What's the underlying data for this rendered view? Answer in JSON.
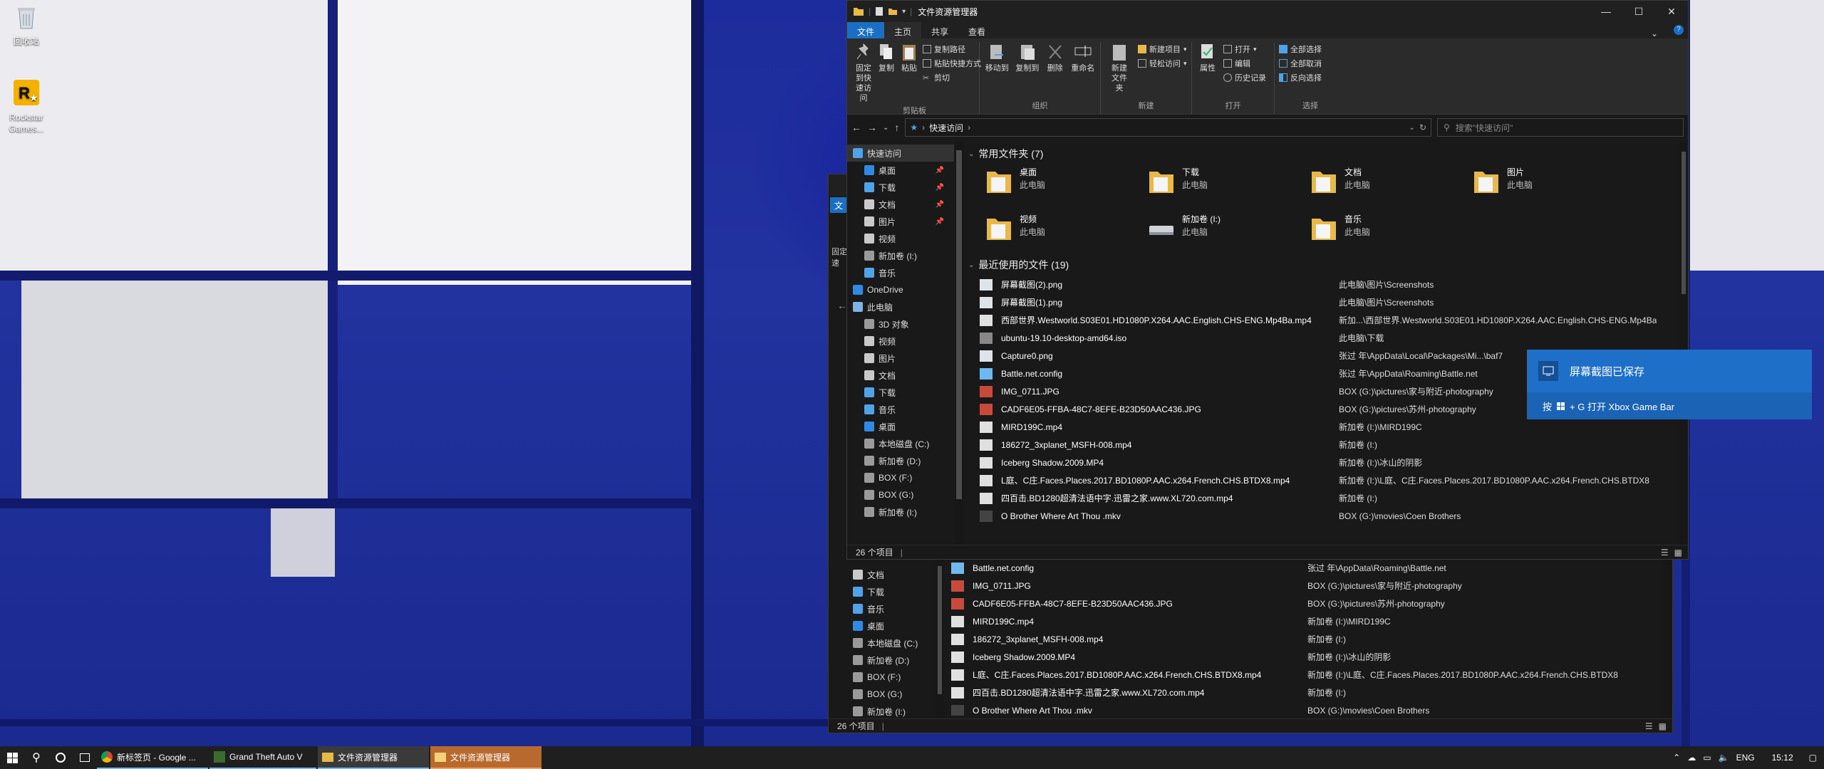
{
  "desktop": {
    "icons": [
      {
        "label": "回收站"
      },
      {
        "label": "Rockstar Games..."
      }
    ]
  },
  "explorer": {
    "title": "文件资源管理器",
    "ribbon_tabs": [
      "文件",
      "主页",
      "共享",
      "查看"
    ],
    "help": "?",
    "ribbon": {
      "clipboard": {
        "pin": "固定到快速访问",
        "copy": "复制",
        "paste": "粘贴",
        "copy_path": "复制路径",
        "paste_shortcut": "粘贴快捷方式",
        "cut": "剪切",
        "label": "剪贴板"
      },
      "organize": {
        "move_to": "移动到",
        "copy_to": "复制到",
        "delete": "删除",
        "rename": "重命名",
        "label": "组织"
      },
      "new": {
        "new_folder": "新建文件夹",
        "new_item": "新建项目",
        "easy_access": "轻松访问",
        "label": "新建"
      },
      "open": {
        "properties": "属性",
        "open": "打开",
        "edit": "编辑",
        "history": "历史记录",
        "label": "打开"
      },
      "select": {
        "select_all": "全部选择",
        "select_none": "全部取消",
        "invert": "反向选择",
        "label": "选择"
      }
    },
    "address": {
      "breadcrumb": "快速访问",
      "search_placeholder": "搜索\"快速访问\""
    },
    "nav": [
      {
        "label": "快速访问",
        "pinned": false,
        "indent": 0
      },
      {
        "label": "桌面",
        "pinned": true,
        "indent": 1
      },
      {
        "label": "下载",
        "pinned": true,
        "indent": 1
      },
      {
        "label": "文档",
        "pinned": true,
        "indent": 1
      },
      {
        "label": "图片",
        "pinned": true,
        "indent": 1
      },
      {
        "label": "视频",
        "pinned": false,
        "indent": 1
      },
      {
        "label": "新加卷 (I:)",
        "pinned": false,
        "indent": 1
      },
      {
        "label": "音乐",
        "pinned": false,
        "indent": 1
      },
      {
        "label": "OneDrive",
        "pinned": false,
        "indent": 0
      },
      {
        "label": "此电脑",
        "pinned": false,
        "indent": 0
      },
      {
        "label": "3D 对象",
        "pinned": false,
        "indent": 1
      },
      {
        "label": "视频",
        "pinned": false,
        "indent": 1
      },
      {
        "label": "图片",
        "pinned": false,
        "indent": 1
      },
      {
        "label": "文档",
        "pinned": false,
        "indent": 1
      },
      {
        "label": "下载",
        "pinned": false,
        "indent": 1
      },
      {
        "label": "音乐",
        "pinned": false,
        "indent": 1
      },
      {
        "label": "桌面",
        "pinned": false,
        "indent": 1
      },
      {
        "label": "本地磁盘 (C:)",
        "pinned": false,
        "indent": 1
      },
      {
        "label": "新加卷 (D:)",
        "pinned": false,
        "indent": 1
      },
      {
        "label": "BOX (F:)",
        "pinned": false,
        "indent": 1
      },
      {
        "label": "BOX (G:)",
        "pinned": false,
        "indent": 1
      },
      {
        "label": "新加卷 (I:)",
        "pinned": false,
        "indent": 1
      }
    ],
    "frequent_header": "常用文件夹 (7)",
    "frequent": [
      {
        "name": "桌面",
        "loc": "此电脑"
      },
      {
        "name": "下载",
        "loc": "此电脑"
      },
      {
        "name": "文档",
        "loc": "此电脑"
      },
      {
        "name": "图片",
        "loc": "此电脑"
      },
      {
        "name": "视频",
        "loc": "此电脑"
      },
      {
        "name": "新加卷 (I:)",
        "loc": "此电脑"
      },
      {
        "name": "音乐",
        "loc": "此电脑"
      }
    ],
    "recent_header": "最近使用的文件 (19)",
    "recent": [
      {
        "name": "屏幕截图(2).png",
        "path": "此电脑\\图片\\Screenshots"
      },
      {
        "name": "屏幕截图(1).png",
        "path": "此电脑\\图片\\Screenshots"
      },
      {
        "name": "西部世界.Westworld.S03E01.HD1080P.X264.AAC.English.CHS-ENG.Mp4Ba.mp4",
        "path": "新加...\\西部世界.Westworld.S03E01.HD1080P.X264.AAC.English.CHS-ENG.Mp4Ba"
      },
      {
        "name": "ubuntu-19.10-desktop-amd64.iso",
        "path": "此电脑\\下载"
      },
      {
        "name": "Capture0.png",
        "path": "张过 年\\AppData\\Local\\Packages\\Mi...\\baf7"
      },
      {
        "name": "Battle.net.config",
        "path": "张过 年\\AppData\\Roaming\\Battle.net"
      },
      {
        "name": "IMG_0711.JPG",
        "path": "BOX (G:)\\pictures\\家与附近-photography"
      },
      {
        "name": "CADF6E05-FFBA-48C7-8EFE-B23D50AAC436.JPG",
        "path": "BOX (G:)\\pictures\\苏州-photography"
      },
      {
        "name": "MIRD199C.mp4",
        "path": "新加卷 (I:)\\MIRD199C"
      },
      {
        "name": "186272_3xplanet_MSFH-008.mp4",
        "path": "新加卷 (I:)"
      },
      {
        "name": "Iceberg Shadow.2009.MP4",
        "path": "新加卷 (I:)\\冰山的阴影"
      },
      {
        "name": "L庭、C庄.Faces.Places.2017.BD1080P.AAC.x264.French.CHS.BTDX8.mp4",
        "path": "新加卷 (I:)\\L庭、C庄.Faces.Places.2017.BD1080P.AAC.x264.French.CHS.BTDX8"
      },
      {
        "name": "四百击.BD1280超清法语中字.迅雷之家.www.XL720.com.mp4",
        "path": "新加卷 (I:)"
      },
      {
        "name": "O Brother Where Art Thou .mkv",
        "path": "BOX (G:)\\movies\\Coen Brothers"
      }
    ],
    "status": "26 个项目"
  },
  "back_window": {
    "nav": [
      {
        "label": "文档"
      },
      {
        "label": "下载"
      },
      {
        "label": "音乐"
      },
      {
        "label": "桌面"
      },
      {
        "label": "本地磁盘 (C:)"
      },
      {
        "label": "新加卷 (D:)"
      },
      {
        "label": "BOX (F:)"
      },
      {
        "label": "BOX (G:)"
      },
      {
        "label": "新加卷 (I:)"
      }
    ],
    "recent": [
      {
        "name": "Battle.net.config",
        "path": "张过 年\\AppData\\Roaming\\Battle.net"
      },
      {
        "name": "IMG_0711.JPG",
        "path": "BOX (G:)\\pictures\\家与附近-photography"
      },
      {
        "name": "CADF6E05-FFBA-48C7-8EFE-B23D50AAC436.JPG",
        "path": "BOX (G:)\\pictures\\苏州-photography"
      },
      {
        "name": "MIRD199C.mp4",
        "path": "新加卷 (I:)\\MIRD199C"
      },
      {
        "name": "186272_3xplanet_MSFH-008.mp4",
        "path": "新加卷 (I:)"
      },
      {
        "name": "Iceberg Shadow.2009.MP4",
        "path": "新加卷 (I:)\\冰山的阴影"
      },
      {
        "name": "L庭、C庄.Faces.Places.2017.BD1080P.AAC.x264.French.CHS.BTDX8.mp4",
        "path": "新加卷 (I:)\\L庭、C庄.Faces.Places.2017.BD1080P.AAC.x264.French.CHS.BTDX8"
      },
      {
        "name": "四百击.BD1280超清法语中字.迅雷之家.www.XL720.com.mp4",
        "path": "新加卷 (I:)"
      },
      {
        "name": "O Brother Where Art Thou .mkv",
        "path": "BOX (G:)\\movies\\Coen Brothers"
      }
    ],
    "status": "26 个项目",
    "peek_tab": "文",
    "peek_text": "固定\n速"
  },
  "toast": {
    "title": "屏幕截图已保存",
    "hint_pre": "按",
    "hint_post": "+ G 打开 Xbox Game Bar"
  },
  "taskbar": {
    "tasks": [
      {
        "label": "新标签页 - Google ..."
      },
      {
        "label": "Grand Theft Auto V"
      },
      {
        "label": "文件资源管理器"
      },
      {
        "label": "文件资源管理器"
      }
    ],
    "lang": "ENG",
    "time": "15:12"
  },
  "colors": {
    "accent": "#1a6fc4",
    "toast": "#1e6fc7",
    "folder": "#e8b84a"
  }
}
